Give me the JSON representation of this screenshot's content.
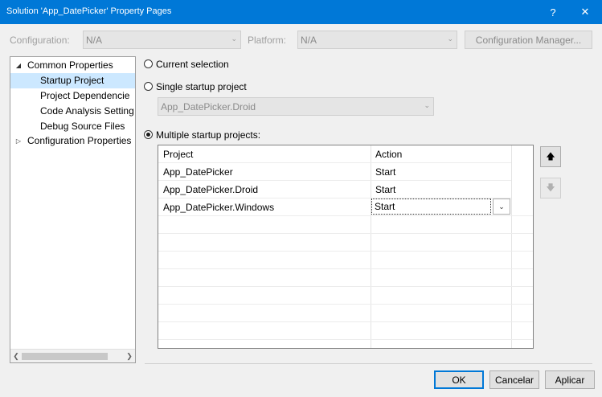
{
  "window": {
    "title": "Solution 'App_DatePicker' Property Pages",
    "help_glyph": "?",
    "close_glyph": "✕"
  },
  "config": {
    "configuration_label": "Configuration:",
    "configuration_value": "N/A",
    "platform_label": "Platform:",
    "platform_value": "N/A",
    "manager_button": "Configuration Manager..."
  },
  "tree": {
    "root_label": "Common Properties",
    "items": [
      {
        "label": "Startup Project",
        "selected": true
      },
      {
        "label": "Project Dependencie"
      },
      {
        "label": "Code Analysis Setting"
      },
      {
        "label": "Debug Source Files"
      }
    ],
    "config_properties_label": "Configuration Properties"
  },
  "startup": {
    "current_selection_label": "Current selection",
    "single_label": "Single startup project",
    "single_value": "App_DatePicker.Droid",
    "multiple_label": "Multiple startup projects:",
    "selected_option": "multiple"
  },
  "grid": {
    "columns": [
      "Project",
      "Action"
    ],
    "rows": [
      {
        "project": "App_DatePicker",
        "action": "Start"
      },
      {
        "project": "App_DatePicker.Droid",
        "action": "Start"
      },
      {
        "project": "App_DatePicker.Windows",
        "action": "Start"
      }
    ]
  },
  "buttons": {
    "ok": "OK",
    "cancel": "Cancelar",
    "apply": "Aplicar"
  },
  "colors": {
    "titlebar": "#0078d7",
    "selection": "#cce8ff"
  }
}
